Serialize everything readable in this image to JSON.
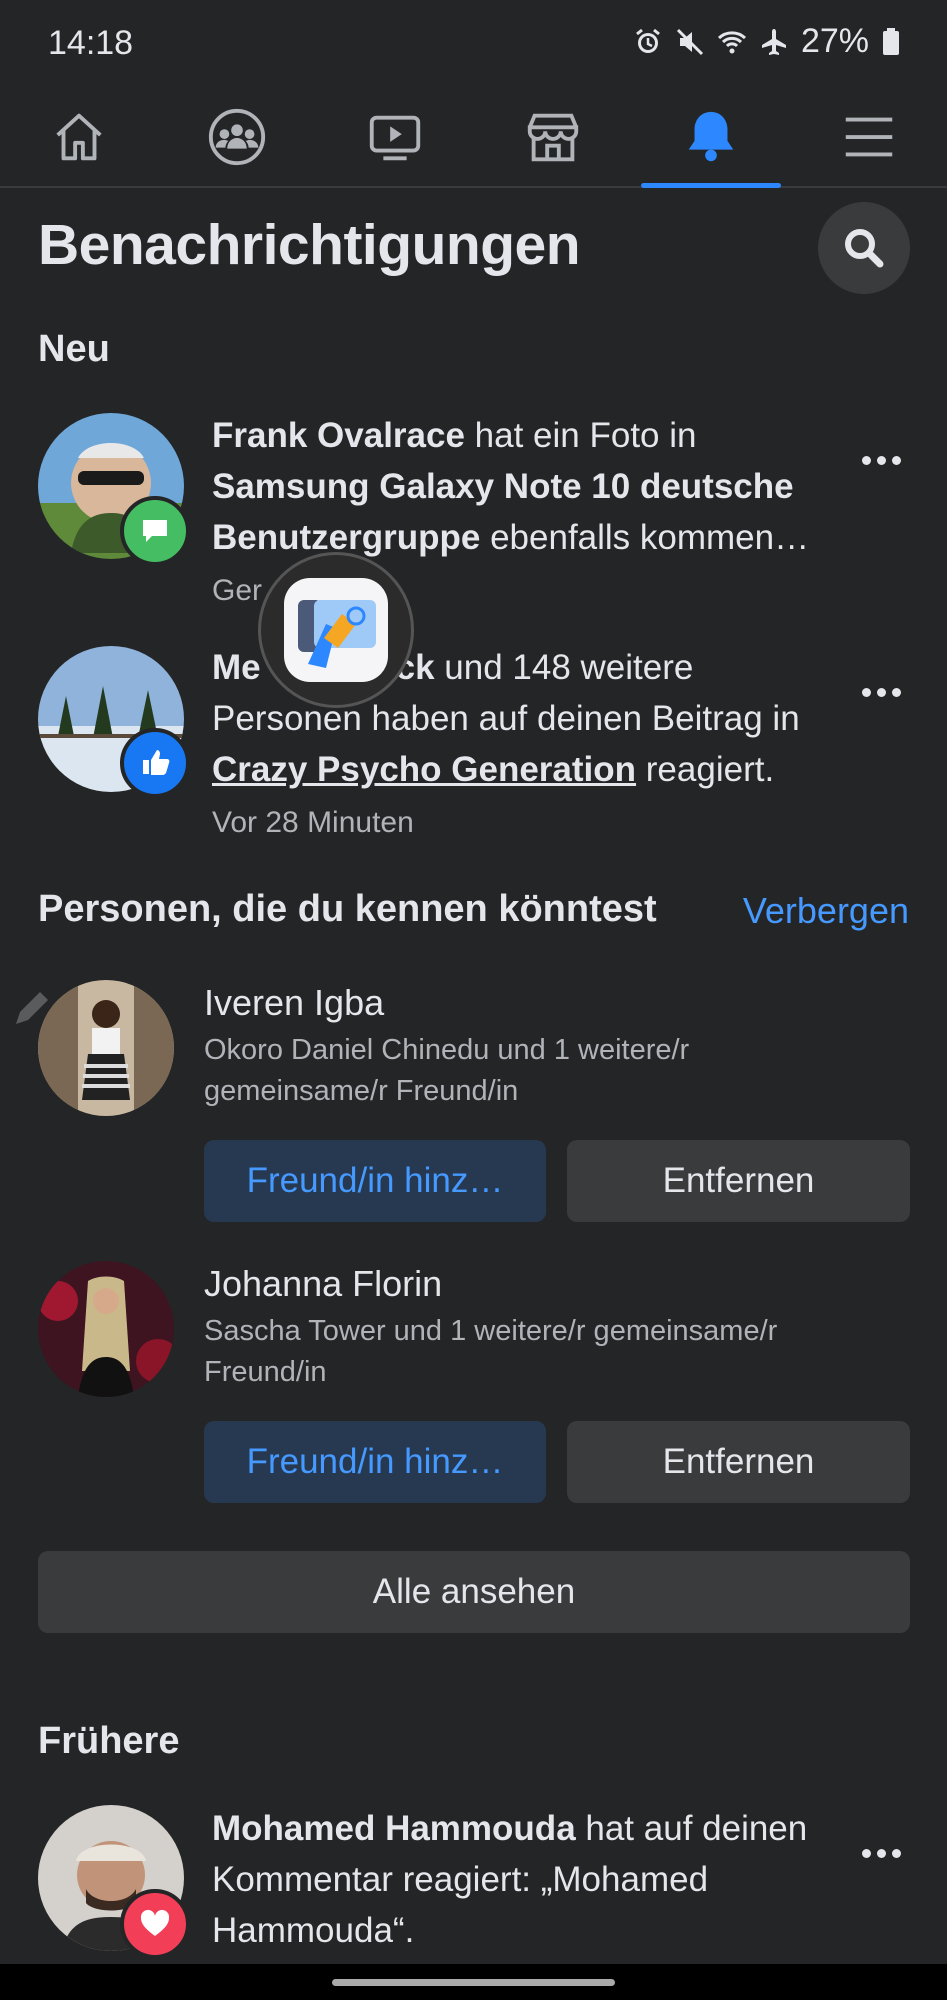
{
  "status": {
    "time": "14:18",
    "battery": "27%"
  },
  "nav": {
    "tabs": [
      {
        "icon": "home-icon"
      },
      {
        "icon": "groups-icon"
      },
      {
        "icon": "video-icon"
      },
      {
        "icon": "marketplace-icon"
      },
      {
        "icon": "bell-icon",
        "active": true
      },
      {
        "icon": "menu-icon"
      }
    ]
  },
  "header": {
    "title": "Benachrichtigungen"
  },
  "sections": {
    "new_title": "Neu",
    "people_title": "Personen, die du kennen könntest",
    "hide_label": "Verbergen",
    "earlier_title": "Frühere"
  },
  "notifications": [
    {
      "actor": "Frank Ovalrace",
      "text1": " hat ein Foto in ",
      "group": "Samsung Galaxy Note 10 deutsche Benutzergruppe",
      "text2": " ebenfalls kommen…",
      "time": "Ger",
      "badge": "comment-icon"
    },
    {
      "actor": "Me",
      "actor_tail": "ck",
      "text1": " und 148 weitere Personen haben auf deinen Beitrag in ",
      "group": "Crazy Psycho Generation",
      "text2": " reagiert.",
      "time": "Vor 28 Minuten",
      "badge": "like-icon"
    },
    {
      "actor": "Mohamed Hammouda",
      "text1": " hat auf deinen Kommentar reagiert: „Mohamed Hammouda“.",
      "badge": "heart-icon"
    }
  ],
  "people": [
    {
      "name": "Iveren Igba",
      "mutual": "Okoro Daniel Chinedu und 1 weitere/r gemeinsame/r Freund/in",
      "add_label": "Freund/in hinz…",
      "remove_label": "Entfernen"
    },
    {
      "name": "Johanna Florin",
      "mutual": "Sascha Tower und 1 weitere/r gemeinsame/r Freund/in",
      "add_label": "Freund/in hinz…",
      "remove_label": "Entfernen"
    }
  ],
  "see_all_label": "Alle ansehen",
  "colors": {
    "background": "#242526",
    "accent": "#2d88ff",
    "link": "#4599ff",
    "secondary_text": "#b0b3b8"
  }
}
